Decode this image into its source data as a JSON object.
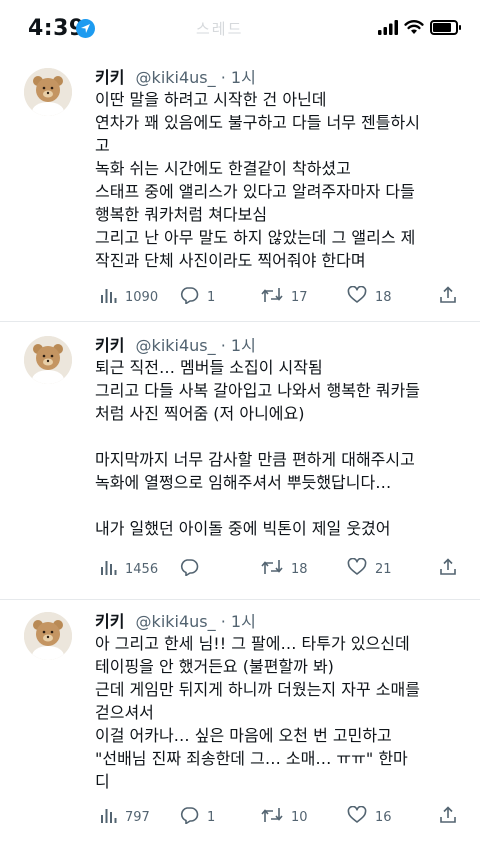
{
  "status_bar": {
    "time": "4:39",
    "faded_title": "스레드"
  },
  "tweets": [
    {
      "name": "키키",
      "handle": "@kiki4us_",
      "separator": "·",
      "ago": "1시",
      "lines": [
        "이딴 말을 하려고 시작한 건 아닌데",
        "연차가 꽤 있음에도 불구하고 다들 너무 젠틀하시",
        "고",
        "녹화 쉬는 시간에도 한결같이 착하셨고",
        "스태프 중에 앨리스가 있다고 알려주자마자 다들",
        "행복한 쿼카처럼 쳐다보심",
        "그리고 난 아무 말도 하지 않았는데 그 앨리스 제",
        "작진과 단체 사진이라도 찍어줘야 한다며"
      ],
      "views": "1090",
      "replies": "1",
      "retweets": "17",
      "likes": "18"
    },
    {
      "name": "키키",
      "handle": "@kiki4us_",
      "separator": "·",
      "ago": "1시",
      "lines": [
        "퇴근 직전… 멤버들 소집이 시작됨",
        "그리고 다들 사복 갈아입고 나와서 행복한 쿼카들",
        "처럼 사진 찍어줌 (저 아니에요)",
        "",
        "마지막까지 너무 감사할 만큼 편하게 대해주시고",
        "녹화에 열쩡으로 임해주셔서 뿌듯했답니다…",
        "",
        "내가 일했던 아이돌 중에 빅톤이 제일 웃겼어"
      ],
      "views": "1456",
      "replies": "",
      "retweets": "18",
      "likes": "21"
    },
    {
      "name": "키키",
      "handle": "@kiki4us_",
      "separator": "·",
      "ago": "1시",
      "lines": [
        "아 그리고 한세 님!! 그 팔에… 타투가 있으신데",
        "테이핑을 안 했거든요 (불편할까 봐)",
        "근데 게임만 뒤지게 하니까 더웠는지 자꾸 소매를",
        "걷으셔서",
        "이걸 어카나… 싶은 마음에 오천 번 고민하고",
        "\"선배님 진짜 죄송한데 그… 소매… ㅠㅠ\" 한마",
        "디"
      ],
      "views": "797",
      "replies": "1",
      "retweets": "10",
      "likes": "16"
    }
  ]
}
